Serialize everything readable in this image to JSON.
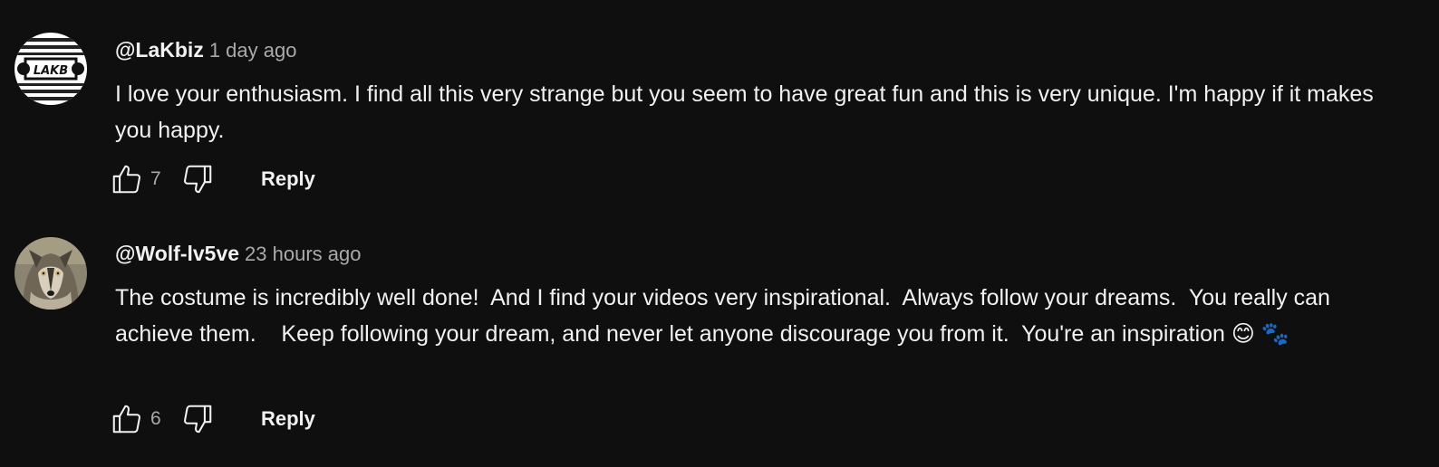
{
  "comments": [
    {
      "author": "@LaKbiz",
      "timestamp": "1 day ago",
      "text": "I love your enthusiasm. I find all this very strange but you seem to have great fun and this is very unique. I'm happy if it makes you happy.",
      "like_count": "7",
      "reply_label": "Reply",
      "avatar_text": "LAKBIZ"
    },
    {
      "author": "@Wolf-lv5ve",
      "timestamp": "23 hours ago",
      "text": "The costume is incredibly well done!  And I find your videos very inspirational.  Always follow your dreams.  You really can achieve them.    Keep following your dream, and never let anyone discourage you from it.  You're an inspiration 😊 🐾",
      "like_count": "6",
      "reply_label": "Reply"
    }
  ],
  "icons": {
    "like": "thumbs-up-icon",
    "dislike": "thumbs-down-icon"
  },
  "colors": {
    "background": "#0f0f0f",
    "primary_text": "#f1f1f1",
    "secondary_text": "#aaaaaa"
  }
}
